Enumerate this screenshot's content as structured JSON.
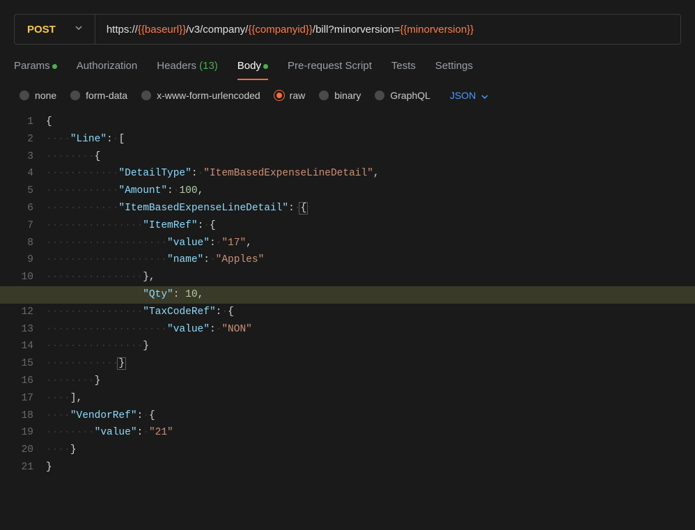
{
  "request": {
    "method": "POST",
    "url_parts": [
      {
        "text": "https://",
        "var": false
      },
      {
        "text": "{{baseurl}}",
        "var": true
      },
      {
        "text": "/v3/company/",
        "var": false
      },
      {
        "text": "{{companyid}}",
        "var": true
      },
      {
        "text": "/bill?minorversion=",
        "var": false
      },
      {
        "text": "{{minorversion}}",
        "var": true
      }
    ]
  },
  "tabs": [
    {
      "label": "Params",
      "active": false,
      "dot": true
    },
    {
      "label": "Authorization",
      "active": false
    },
    {
      "label": "Headers",
      "count": "(13)",
      "active": false
    },
    {
      "label": "Body",
      "active": true,
      "dot": true
    },
    {
      "label": "Pre-request Script",
      "active": false
    },
    {
      "label": "Tests",
      "active": false
    },
    {
      "label": "Settings",
      "active": false
    }
  ],
  "body_types": [
    {
      "label": "none",
      "selected": false
    },
    {
      "label": "form-data",
      "selected": false
    },
    {
      "label": "x-www-form-urlencoded",
      "selected": false
    },
    {
      "label": "raw",
      "selected": true
    },
    {
      "label": "binary",
      "selected": false
    },
    {
      "label": "GraphQL",
      "selected": false
    }
  ],
  "format": "JSON",
  "code": {
    "line_count": 21,
    "highlighted_line": 11,
    "lines": [
      [
        {
          "t": "punct",
          "v": "{"
        }
      ],
      [
        {
          "t": "ws",
          "v": "····"
        },
        {
          "t": "key",
          "v": "\"Line\""
        },
        {
          "t": "punct",
          "v": ":"
        },
        {
          "t": "ws",
          "v": "·"
        },
        {
          "t": "punct",
          "v": "["
        }
      ],
      [
        {
          "t": "ws",
          "v": "········"
        },
        {
          "t": "punct",
          "v": "{"
        }
      ],
      [
        {
          "t": "ws",
          "v": "············"
        },
        {
          "t": "key",
          "v": "\"DetailType\""
        },
        {
          "t": "punct",
          "v": ":"
        },
        {
          "t": "ws",
          "v": "·"
        },
        {
          "t": "string",
          "v": "\"ItemBasedExpenseLineDetail\""
        },
        {
          "t": "punct",
          "v": ","
        }
      ],
      [
        {
          "t": "ws",
          "v": "············"
        },
        {
          "t": "key",
          "v": "\"Amount\""
        },
        {
          "t": "punct",
          "v": ":"
        },
        {
          "t": "ws",
          "v": "·"
        },
        {
          "t": "number",
          "v": "100"
        },
        {
          "t": "punct",
          "v": ","
        }
      ],
      [
        {
          "t": "ws",
          "v": "············"
        },
        {
          "t": "key",
          "v": "\"ItemBasedExpenseLineDetail\""
        },
        {
          "t": "punct",
          "v": ":"
        },
        {
          "t": "ws",
          "v": "·"
        },
        {
          "t": "bracebox",
          "v": "{"
        }
      ],
      [
        {
          "t": "ws",
          "v": "················"
        },
        {
          "t": "key",
          "v": "\"ItemRef\""
        },
        {
          "t": "punct",
          "v": ":"
        },
        {
          "t": "ws",
          "v": "·"
        },
        {
          "t": "punct",
          "v": "{"
        }
      ],
      [
        {
          "t": "ws",
          "v": "····················"
        },
        {
          "t": "key",
          "v": "\"value\""
        },
        {
          "t": "punct",
          "v": ":"
        },
        {
          "t": "ws",
          "v": "·"
        },
        {
          "t": "string",
          "v": "\"17\""
        },
        {
          "t": "punct",
          "v": ","
        }
      ],
      [
        {
          "t": "ws",
          "v": "····················"
        },
        {
          "t": "key",
          "v": "\"name\""
        },
        {
          "t": "punct",
          "v": ":"
        },
        {
          "t": "ws",
          "v": "·"
        },
        {
          "t": "string",
          "v": "\"Apples\""
        }
      ],
      [
        {
          "t": "ws",
          "v": "················"
        },
        {
          "t": "punct",
          "v": "},"
        }
      ],
      [
        {
          "t": "ws",
          "v": "················"
        },
        {
          "t": "key",
          "v": "\"Qty\""
        },
        {
          "t": "punct",
          "v": ":"
        },
        {
          "t": "ws",
          "v": "·"
        },
        {
          "t": "number",
          "v": "10"
        },
        {
          "t": "punct",
          "v": ","
        }
      ],
      [
        {
          "t": "ws",
          "v": "················"
        },
        {
          "t": "key",
          "v": "\"TaxCodeRef\""
        },
        {
          "t": "punct",
          "v": ":"
        },
        {
          "t": "ws",
          "v": "·"
        },
        {
          "t": "punct",
          "v": "{"
        }
      ],
      [
        {
          "t": "ws",
          "v": "····················"
        },
        {
          "t": "key",
          "v": "\"value\""
        },
        {
          "t": "punct",
          "v": ":"
        },
        {
          "t": "ws",
          "v": "·"
        },
        {
          "t": "string",
          "v": "\"NON\""
        }
      ],
      [
        {
          "t": "ws",
          "v": "················"
        },
        {
          "t": "punct",
          "v": "}"
        }
      ],
      [
        {
          "t": "ws",
          "v": "············"
        },
        {
          "t": "bracebox",
          "v": "}"
        }
      ],
      [
        {
          "t": "ws",
          "v": "········"
        },
        {
          "t": "punct",
          "v": "}"
        }
      ],
      [
        {
          "t": "ws",
          "v": "····"
        },
        {
          "t": "punct",
          "v": "],"
        }
      ],
      [
        {
          "t": "ws",
          "v": "····"
        },
        {
          "t": "key",
          "v": "\"VendorRef\""
        },
        {
          "t": "punct",
          "v": ":"
        },
        {
          "t": "ws",
          "v": "·"
        },
        {
          "t": "punct",
          "v": "{"
        }
      ],
      [
        {
          "t": "ws",
          "v": "········"
        },
        {
          "t": "key",
          "v": "\"value\""
        },
        {
          "t": "punct",
          "v": ":"
        },
        {
          "t": "ws",
          "v": "·"
        },
        {
          "t": "string",
          "v": "\"21\""
        }
      ],
      [
        {
          "t": "ws",
          "v": "····"
        },
        {
          "t": "punct",
          "v": "}"
        }
      ],
      [
        {
          "t": "punct",
          "v": "}"
        }
      ]
    ]
  }
}
